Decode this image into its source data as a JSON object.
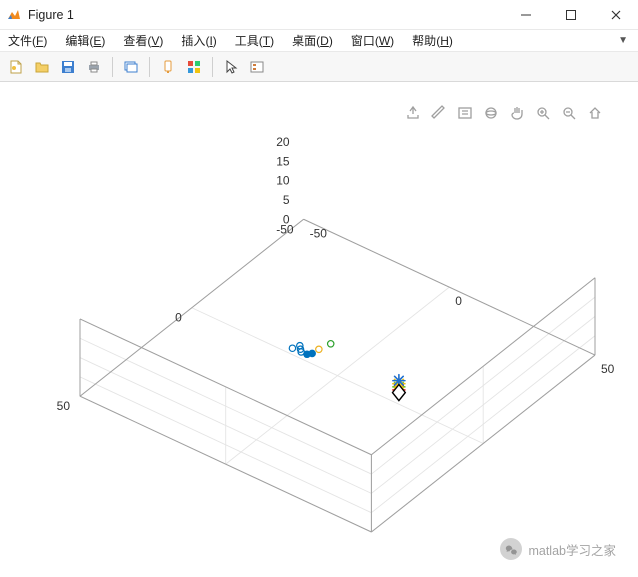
{
  "window": {
    "title": "Figure 1"
  },
  "menu": {
    "file": {
      "label": "文件",
      "key": "F"
    },
    "edit": {
      "label": "编辑",
      "key": "E"
    },
    "view": {
      "label": "查看",
      "key": "V"
    },
    "insert": {
      "label": "插入",
      "key": "I"
    },
    "tools": {
      "label": "工具",
      "key": "T"
    },
    "desktop": {
      "label": "桌面",
      "key": "D"
    },
    "window": {
      "label": "窗口",
      "key": "W"
    },
    "help": {
      "label": "帮助",
      "key": "H"
    }
  },
  "toolbar_icons": [
    "new-figure",
    "open-file",
    "save",
    "print",
    "|",
    "link-plot",
    "|",
    "data-cursor",
    "color-grid",
    "|",
    "pointer",
    "insert-legend"
  ],
  "axes_tools": [
    "export",
    "brush",
    "note",
    "rotate-3d",
    "pan",
    "zoom-in",
    "zoom-out",
    "home"
  ],
  "watermark": {
    "text": "matlab学习之家"
  },
  "chart_data": {
    "type": "scatter",
    "dim": 3,
    "xlabel": "",
    "ylabel": "",
    "zlabel": "",
    "xlim": [
      -50,
      50
    ],
    "xticks": [
      -50,
      0,
      50
    ],
    "ylim": [
      -50,
      50
    ],
    "yticks": [
      -50,
      0,
      50
    ],
    "zlim": [
      0,
      20
    ],
    "zticks": [
      0,
      5,
      10,
      15,
      20
    ],
    "grid": true,
    "series": [
      {
        "name": "blue-open-circles",
        "marker": "o",
        "color": "#0072bd",
        "fill": "none",
        "points": [
          [
            -17,
            -2,
            0.2
          ],
          [
            -16,
            -4,
            0.3
          ],
          [
            -15,
            -3,
            0.2
          ],
          [
            -14,
            -2,
            0.3
          ]
        ]
      },
      {
        "name": "blue-filled-circles",
        "marker": "o",
        "color": "#0072bd",
        "fill": "#0072bd",
        "points": [
          [
            -12,
            -2,
            0.4
          ],
          [
            -11,
            -3,
            0.5
          ]
        ]
      },
      {
        "name": "yellow-circle",
        "marker": "o",
        "color": "#edb120",
        "fill": "none",
        "points": [
          [
            -11,
            -6,
            0.2
          ]
        ]
      },
      {
        "name": "green-circle",
        "marker": "o",
        "color": "#2ca02c",
        "fill": "none",
        "points": [
          [
            -10,
            -10,
            0.15
          ]
        ]
      },
      {
        "name": "red-star",
        "marker": "*",
        "color": "#e2231a",
        "points": [
          [
            18,
            -4,
            0.8
          ]
        ]
      },
      {
        "name": "green-star",
        "marker": "*",
        "color": "#6fbf2a",
        "points": [
          [
            18,
            -4,
            1.6
          ]
        ]
      },
      {
        "name": "yellow-star",
        "marker": "*",
        "color": "#f4c20d",
        "points": [
          [
            18,
            -4,
            2.4
          ]
        ]
      },
      {
        "name": "blue-star",
        "marker": "*",
        "color": "#1f6fd0",
        "points": [
          [
            18,
            -4,
            3.2
          ]
        ]
      },
      {
        "name": "black-diamond",
        "marker": "diamond",
        "color": "#000000",
        "fill": "none",
        "points": [
          [
            18,
            -4,
            0.1
          ]
        ]
      }
    ]
  }
}
